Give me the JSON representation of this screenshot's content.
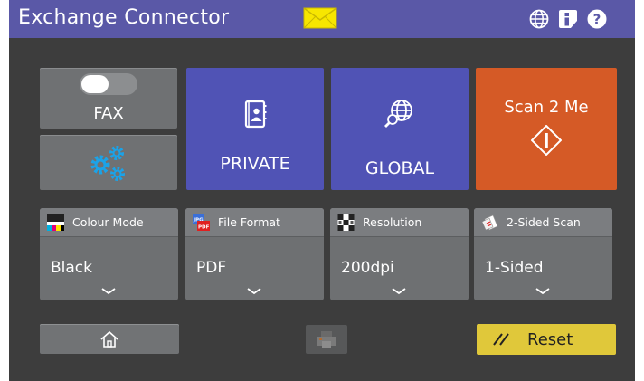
{
  "titlebar": {
    "title": "Exchange Connector",
    "icons": [
      "mail-icon",
      "globe-icon",
      "info-icon",
      "help-icon"
    ]
  },
  "tiles": {
    "fax": {
      "label": "FAX",
      "toggle_on": false
    },
    "settings": {
      "icon": "gears-icon"
    },
    "private": {
      "label": "PRIVATE",
      "icon": "contact-book-icon"
    },
    "global": {
      "label": "GLOBAL",
      "icon": "globe-search-icon"
    },
    "scan2me": {
      "label": "Scan 2 Me",
      "icon": "start-diamond-icon"
    }
  },
  "options": [
    {
      "label": "Colour Mode",
      "value": "Black",
      "icon": "colour-mode-icon"
    },
    {
      "label": "File Format",
      "value": "PDF",
      "icon": "file-format-icon"
    },
    {
      "label": "Resolution",
      "value": "200dpi",
      "icon": "resolution-icon"
    },
    {
      "label": "2-Sided Scan",
      "value": "1-Sided",
      "icon": "duplex-icon"
    }
  ],
  "bottom": {
    "home": {
      "icon": "home-icon"
    },
    "job": {
      "icon": "job-status-icon",
      "enabled": false
    },
    "reset": {
      "label": "Reset",
      "icon": "eraser-icon"
    }
  },
  "colors": {
    "titlebar": "#5a58a7",
    "tile_blue": "#5053b5",
    "tile_orange": "#d55a26",
    "tile_gray": "#6f7173",
    "reset_yellow": "#e0c83a",
    "mail_yellow": "#f7e600",
    "gear_blue": "#1ba3e8"
  }
}
